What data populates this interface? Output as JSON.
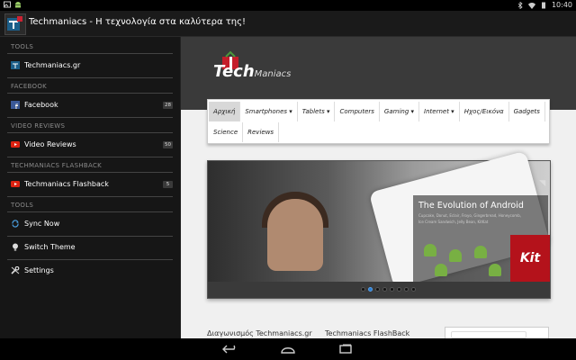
{
  "status_bar": {
    "time": "10:40",
    "icons": [
      "image-icon",
      "android-icon",
      "bluetooth-icon",
      "wifi-icon",
      "battery-icon"
    ]
  },
  "action_bar": {
    "title": "Techmaniacs - Η τεχνολογία στα καλύτερα της!"
  },
  "drawer": {
    "sections": [
      {
        "header": "TOOLS",
        "items": [
          {
            "label": "Techmaniacs.gr",
            "icon": "techmaniacs-icon"
          }
        ]
      },
      {
        "header": "FACEBOOK",
        "items": [
          {
            "label": "Facebook",
            "icon": "facebook-icon",
            "badge": "28"
          }
        ]
      },
      {
        "header": "VIDEO REVIEWS",
        "items": [
          {
            "label": "Video Reviews",
            "icon": "youtube-icon",
            "badge": "50"
          }
        ]
      },
      {
        "header": "TECHMANIACS FLASHBACK",
        "items": [
          {
            "label": "Techmaniacs Flashback",
            "icon": "youtube-icon",
            "badge": "5"
          }
        ]
      },
      {
        "header": "TOOLS",
        "items": [
          {
            "label": "Sync Now",
            "icon": "sync-icon"
          },
          {
            "label": "Switch Theme",
            "icon": "lightbulb-icon"
          },
          {
            "label": "Settings",
            "icon": "wrench-icon"
          }
        ]
      }
    ]
  },
  "site": {
    "logo": {
      "text": "Tech",
      "suffix": "Maniacs"
    },
    "nav_row1": [
      "Αρχική",
      "Smartphones",
      "Tablets",
      "Computers",
      "Gaming",
      "Internet",
      "Ηχος/Εικόνα",
      "Gadgets"
    ],
    "nav_dropdown_flags": [
      false,
      true,
      true,
      false,
      true,
      true,
      false,
      false
    ],
    "nav_row2": [
      "Science",
      "Reviews"
    ],
    "slider": {
      "title": "The Evolution of Android",
      "subtitle": "Cupcake, Donut, Eclair, Froyo, Gingerbread, Honeycomb,",
      "subtitle2": "Ice Cream Sandwich, Jelly Bean, KitKat",
      "promo": "Kit",
      "dot_count": 8,
      "active_dot": 1
    },
    "bottom_left": "Διαγωνισμός Techmaniacs.gr",
    "bottom_right": "Techmaniacs FlashBack"
  },
  "nav_buttons": [
    "back-icon",
    "home-icon",
    "recents-icon"
  ]
}
